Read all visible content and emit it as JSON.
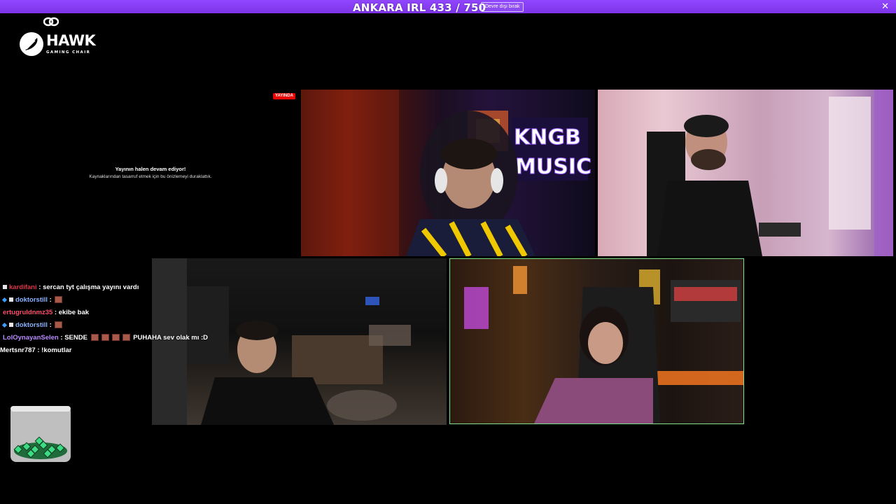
{
  "banner": {
    "title": "ANKARA IRL 433 / 750",
    "button_label": "Devre dışı bırak",
    "close_icon": "close-icon",
    "color": "#9146ff"
  },
  "sponsor": {
    "name": "HAWK",
    "tagline": "GAMING CHAIR"
  },
  "preview": {
    "live_badge": "YAYINDA",
    "title": "Yayının halen devam ediyor!",
    "subtitle": "Kaynaklarından tasarruf etmek için bu önizlemeyi duraklattık."
  },
  "cameras": {
    "overlay_text": [
      "KNGB",
      "MUSIC"
    ]
  },
  "chat": {
    "messages": [
      {
        "user": "kardifani",
        "user_color": "#e0364a",
        "badges": [
          "square"
        ],
        "text": "sercan tyt çalışma yayını vardı",
        "emotes": 0
      },
      {
        "user": "doktorstill",
        "user_color": "#8ab4ff",
        "badges": [
          "cube",
          "square"
        ],
        "text": "",
        "emotes": 1
      },
      {
        "user": "ertugruldnmz35",
        "user_color": "#ff4d6a",
        "badges": [],
        "text": "ekibe bak",
        "emotes": 0
      },
      {
        "user": "doktorstill",
        "user_color": "#8ab4ff",
        "badges": [
          "cube",
          "square"
        ],
        "text": "",
        "emotes": 1
      },
      {
        "user": "LolOynayanSelen",
        "user_color": "#b98bff",
        "badges": [],
        "text": "SENDE",
        "text_after": "PUHAHA sev olak mı :D",
        "emotes": 4
      },
      {
        "user": "Mertsnr787",
        "user_color": "#ffffff",
        "badges": [],
        "text": "!komutlar",
        "emotes": 0
      }
    ]
  },
  "jar": {
    "icon": "glass-jar-icon"
  }
}
